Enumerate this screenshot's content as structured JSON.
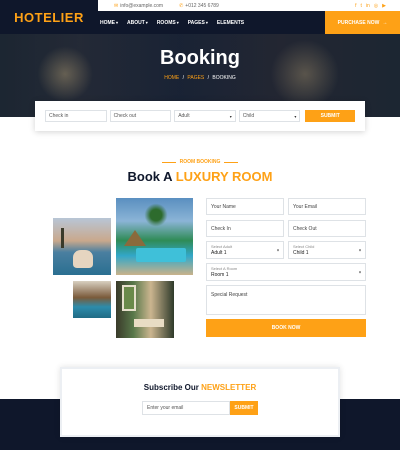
{
  "brand": {
    "logo": "HOTELIER"
  },
  "topbar": {
    "email": "info@example.com",
    "phone": "+012 345 6789",
    "social_icons": [
      "facebook-icon",
      "twitter-icon",
      "linkedin-icon",
      "instagram-icon",
      "youtube-icon"
    ]
  },
  "nav": {
    "items": [
      {
        "label": "HOME",
        "has_dropdown": true
      },
      {
        "label": "ABOUT",
        "has_dropdown": true
      },
      {
        "label": "ROOMS",
        "has_dropdown": true
      },
      {
        "label": "PAGES",
        "has_dropdown": true
      },
      {
        "label": "ELEMENTS",
        "has_dropdown": false
      }
    ],
    "cta_label": "PURCHASE NOW"
  },
  "hero": {
    "title": "Booking",
    "breadcrumb": [
      "HOME",
      "PAGES",
      "BOOKING"
    ]
  },
  "booking_bar": {
    "check_in": "Check in",
    "check_out": "Check out",
    "adult": "Adult",
    "child": "Child",
    "submit": "SUBMIT"
  },
  "section": {
    "tag": "ROOM BOOKING",
    "title_prefix": "Book A",
    "title_highlight": "LUXURY ROOM"
  },
  "form": {
    "name_placeholder": "Your Name",
    "email_placeholder": "Your Email",
    "check_in": "Check In",
    "check_out": "Check Out",
    "adult_label": "Select Adult",
    "adult_value": "Adult 1",
    "child_label": "Select Child",
    "child_value": "Child 1",
    "room_label": "Select A Room",
    "room_value": "Room 1",
    "request_placeholder": "Special Request",
    "book_now": "BOOK NOW"
  },
  "newsletter": {
    "title_prefix": "Subscribe Our",
    "title_highlight": "NEWSLETTER",
    "input_placeholder": "Enter your email",
    "submit": "SUBMIT"
  },
  "colors": {
    "accent": "#fea116",
    "dark": "#0f172b"
  }
}
